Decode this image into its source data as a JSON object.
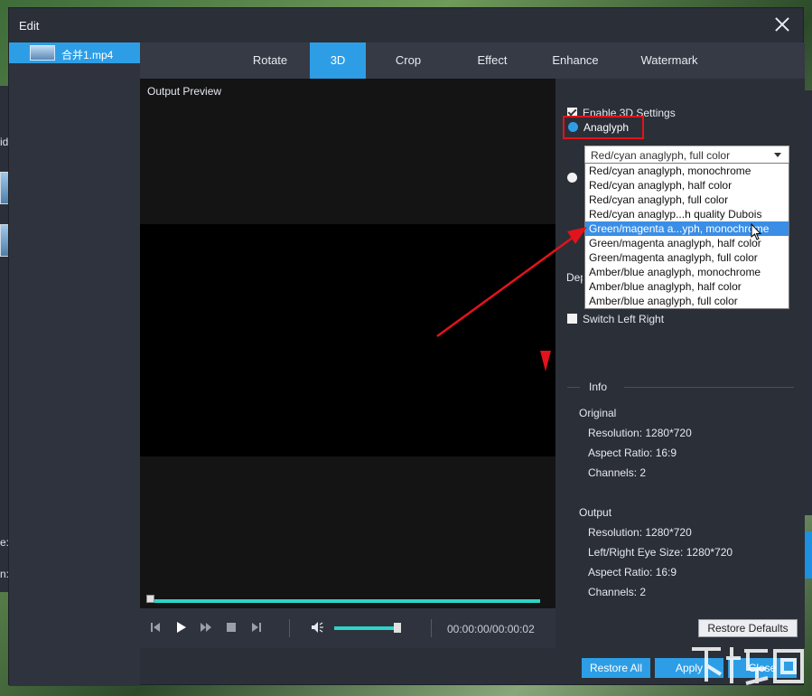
{
  "dialog": {
    "title": "Edit",
    "file_name": "合并1.mp4"
  },
  "tabs": [
    {
      "label": "Rotate"
    },
    {
      "label": "3D"
    },
    {
      "label": "Crop"
    },
    {
      "label": "Effect"
    },
    {
      "label": "Enhance"
    },
    {
      "label": "Watermark"
    }
  ],
  "active_tab": "3D",
  "preview": {
    "label": "Output Preview",
    "time": "00:00:00/00:00:02",
    "timeline_progress": 1.0,
    "volume_level": 0.95
  },
  "settings": {
    "enable_3d_label": "Enable 3D Settings",
    "enable_3d_checked": true,
    "anaglyph_label": "Anaglyph",
    "anaglyph_selected": true,
    "selected_option": "Red/cyan anaglyph, full color",
    "options": [
      "Red/cyan anaglyph, monochrome",
      "Red/cyan anaglyph, half color",
      "Red/cyan anaglyph, full color",
      "Red/cyan anaglyp...h quality Dubois",
      "Green/magenta a...yph, monochrome",
      "Green/magenta anaglyph, half color",
      "Green/magenta anaglyph, full color",
      "Amber/blue anaglyph, monochrome",
      "Amber/blue anaglyph, half color",
      "Amber/blue anaglyph, full color"
    ],
    "highlighted_option_index": 4,
    "depth_label_partial": "Dep",
    "switch_left_right_label": "Switch Left Right",
    "switch_left_right_checked": false
  },
  "info": {
    "title": "Info",
    "original_heading": "Original",
    "original": {
      "resolution": "Resolution: 1280*720",
      "aspect_ratio": "Aspect Ratio: 16:9",
      "channels": "Channels: 2"
    },
    "output_heading": "Output",
    "output": {
      "resolution": "Resolution: 1280*720",
      "eye_size": "Left/Right Eye Size: 1280*720",
      "aspect_ratio": "Aspect Ratio: 16:9",
      "channels": "Channels: 2"
    }
  },
  "buttons": {
    "restore_defaults": "Restore Defaults",
    "restore_all": "Restore All",
    "apply": "Apply",
    "close": "Close"
  },
  "background": {
    "left_text_1": "id",
    "left_text_2": "e:",
    "left_text_3": "n:",
    "right_text": "V"
  },
  "colors": {
    "accent": "#2d9ee6",
    "timeline": "#2ed3c6",
    "highlight_box": "#e3131b",
    "annotation_arrow": "#e3131b"
  }
}
